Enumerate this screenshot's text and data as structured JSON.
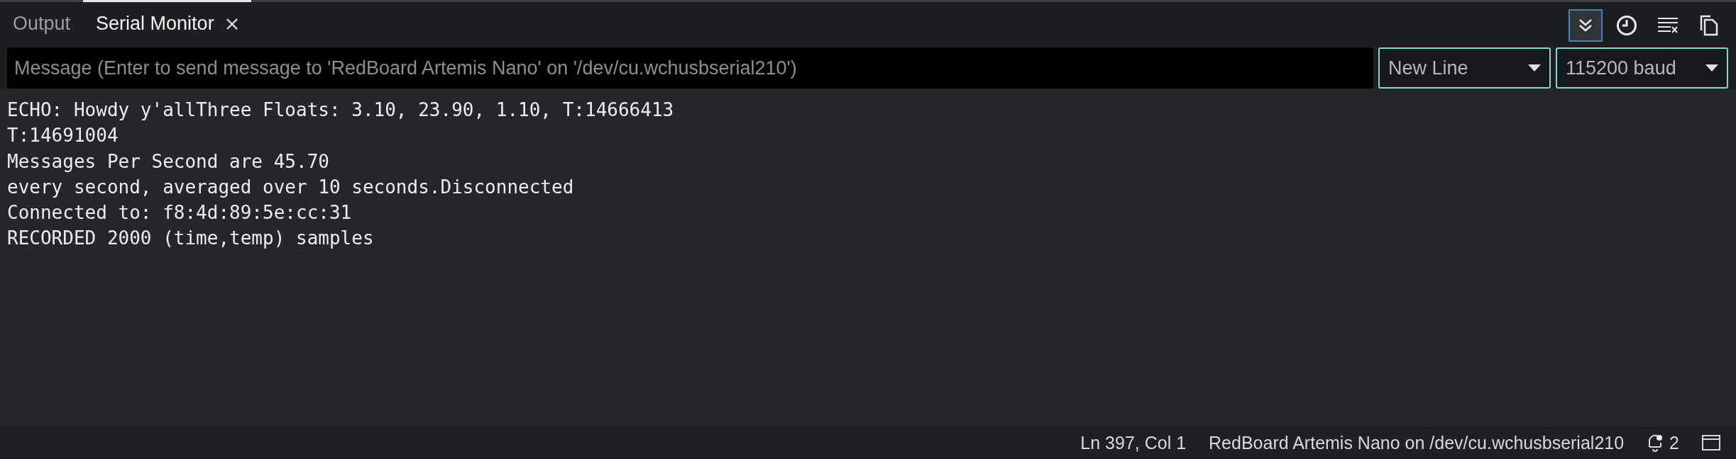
{
  "tabs": [
    {
      "label": "Output",
      "selected": false,
      "closable": false
    },
    {
      "label": "Serial Monitor",
      "selected": true,
      "closable": true
    }
  ],
  "toolbar": [
    {
      "kind": "autoscroll",
      "on": true
    },
    {
      "kind": "timestamp",
      "on": false
    },
    {
      "kind": "clear",
      "on": false
    },
    {
      "kind": "copy",
      "on": false
    }
  ],
  "message_field": {
    "placeholder": "Message (Enter to send message to 'RedBoard Artemis Nano' on '/dev/cu.wchusbserial210')"
  },
  "line_ending": {
    "value": "New Line"
  },
  "baud_rate": {
    "value": "115200 baud"
  },
  "output_lines": [
    "ECHO: Howdy y'allThree Floats: 3.10, 23.90, 1.10, T:14666413",
    "T:14691004",
    "Messages Per Second are 45.70",
    "every second, averaged over 10 seconds.Disconnected",
    "Connected to: f8:4d:89:5e:cc:31",
    "RECORDED 2000 (time,temp) samples"
  ],
  "status_bar": {
    "cursor": "Ln 397, Col 1",
    "board": "RedBoard Artemis Nano on /dev/cu.wchusbserial210",
    "notifications": "2"
  }
}
